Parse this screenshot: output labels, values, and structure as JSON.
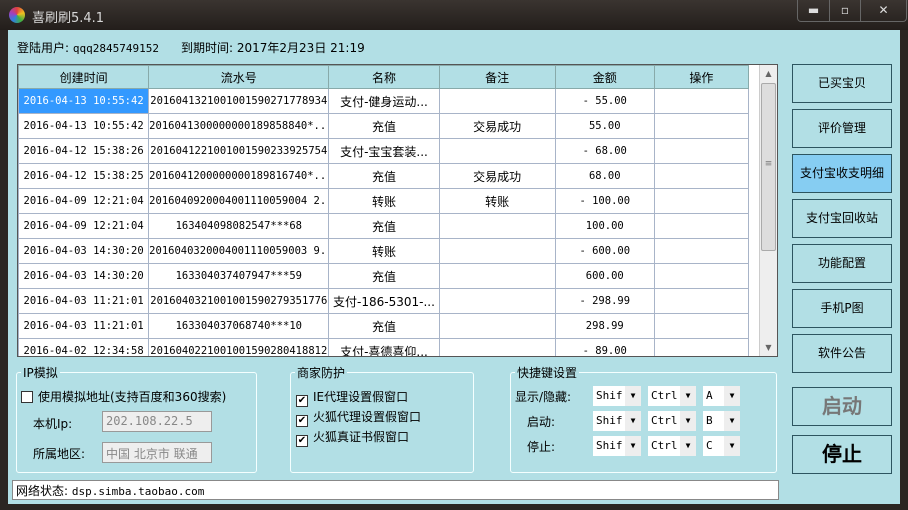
{
  "window": {
    "title": "喜刷刷5.4.1",
    "controls": [
      "minimize",
      "maximize",
      "close"
    ]
  },
  "info": {
    "user_label": "登陆用户:",
    "user": "qqq2845749152",
    "expire_label": "到期时间:",
    "expire": "2017年2月23日 21:19"
  },
  "table": {
    "columns": [
      "创建时间",
      "流水号",
      "名称",
      "备注",
      "金额",
      "操作"
    ],
    "rows": [
      [
        "2016-04-13 10:55:42",
        "2016041321001001590271778934",
        "支付-健身运动...",
        "",
        "- 55.00",
        ""
      ],
      [
        "2016-04-13 10:55:42",
        "2016041300000000189858840*...",
        "充值",
        "交易成功",
        "55.00",
        ""
      ],
      [
        "2016-04-12 15:38:26",
        "2016041221001001590233925754",
        "支付-宝宝套装...",
        "",
        "- 68.00",
        ""
      ],
      [
        "2016-04-12 15:38:25",
        "2016041200000000189816740*...",
        "充值",
        "交易成功",
        "68.00",
        ""
      ],
      [
        "2016-04-09 12:21:04",
        "2016040920004001110059004 2...",
        "转账",
        "转账",
        "- 100.00",
        ""
      ],
      [
        "2016-04-09 12:21:04",
        "163404098082547***68",
        "充值",
        "",
        "100.00",
        ""
      ],
      [
        "2016-04-03 14:30:20",
        "2016040320004001110059003 9...",
        "转账",
        "",
        "- 600.00",
        ""
      ],
      [
        "2016-04-03 14:30:20",
        "163304037407947***59",
        "充值",
        "",
        "600.00",
        ""
      ],
      [
        "2016-04-03 11:21:01",
        "2016040321001001590279351776",
        "支付-186-5301-...",
        "",
        "- 298.99",
        ""
      ],
      [
        "2016-04-03 11:21:01",
        "163304037068740***10",
        "充值",
        "",
        "298.99",
        ""
      ],
      [
        "2016-04-02 12:34:58",
        "2016040221001001590280418812",
        "支付-喜德喜仰...",
        "",
        "- 89.00",
        ""
      ]
    ]
  },
  "side_buttons": [
    "已买宝贝",
    "评价管理",
    "支付宝收支明细",
    "支付宝回收站",
    "功能配置",
    "手机P图",
    "软件公告"
  ],
  "active_side": "支付宝收支明细",
  "start_button": "启动",
  "stop_button": "停止",
  "ip": {
    "legend": "IP模拟",
    "checkbox": "使用模拟地址(支持百度和360搜索)",
    "checked": false,
    "ip_label": "本机Ip:",
    "ip_value": "202.108.22.5",
    "region_label": "所属地区:",
    "region_value": "中国 北京市 联通"
  },
  "protect": {
    "legend": "商家防护",
    "items": [
      {
        "label": "IE代理设置假窗口",
        "checked": true
      },
      {
        "label": "火狐代理设置假窗口",
        "checked": true
      },
      {
        "label": "火狐真证书假窗口",
        "checked": true
      }
    ]
  },
  "hotkeys": {
    "legend": "快捷键设置",
    "rows": [
      {
        "label": "显示/隐藏:",
        "keys": [
          "Shif",
          "Ctrl",
          "A"
        ]
      },
      {
        "label": "启动:",
        "keys": [
          "Shif",
          "Ctrl",
          "B"
        ]
      },
      {
        "label": "停止:",
        "keys": [
          "Shif",
          "Ctrl",
          "C"
        ]
      }
    ]
  },
  "status": {
    "label": "网络状态:",
    "value": "dsp.simba.taobao.com"
  },
  "colors": {
    "background": "#b2dfe5",
    "selected_row": "#3399ff",
    "active_button": "#86cdf2"
  }
}
